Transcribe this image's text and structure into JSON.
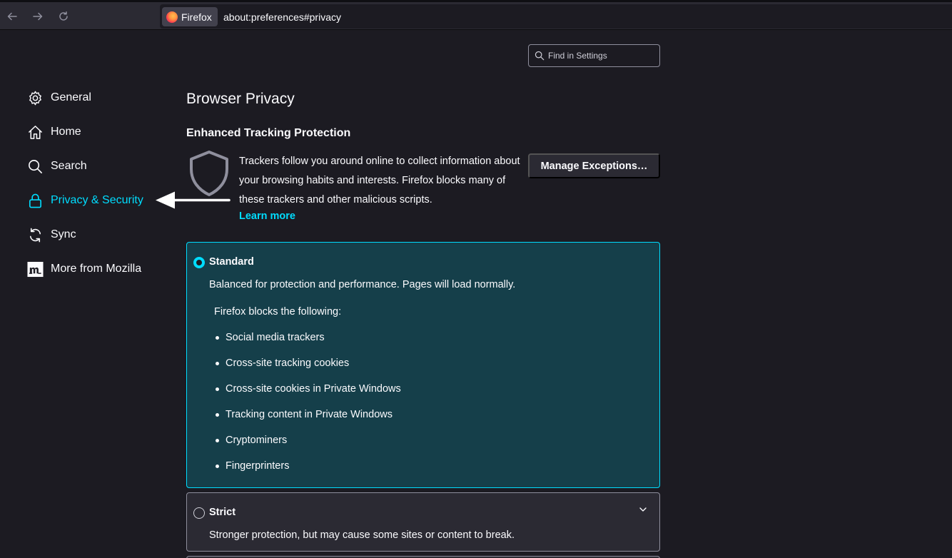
{
  "browser": {
    "identity_label": "Firefox",
    "url": "about:preferences#privacy"
  },
  "search": {
    "placeholder": "Find in Settings"
  },
  "sidebar": {
    "items": [
      {
        "label": "General",
        "icon": "gear-icon"
      },
      {
        "label": "Home",
        "icon": "home-icon"
      },
      {
        "label": "Search",
        "icon": "search-icon"
      },
      {
        "label": "Privacy & Security",
        "icon": "lock-icon",
        "active": true
      },
      {
        "label": "Sync",
        "icon": "sync-icon"
      },
      {
        "label": "More from Mozilla",
        "icon": "mozilla-icon"
      }
    ]
  },
  "main": {
    "title": "Browser Privacy",
    "etp": {
      "heading": "Enhanced Tracking Protection",
      "description": "Trackers follow you around online to collect information about your browsing habits and interests. Firefox blocks many of these trackers and other malicious scripts.",
      "learn_more": "Learn more",
      "manage_button": "Manage Exceptions…"
    },
    "options": {
      "standard": {
        "label": "Standard",
        "description": "Balanced for protection and performance. Pages will load normally.",
        "blocks_title": "Firefox blocks the following:",
        "blocks": [
          "Social media trackers",
          "Cross-site tracking cookies",
          "Cross-site cookies in Private Windows",
          "Tracking content in Private Windows",
          "Cryptominers",
          "Fingerprinters"
        ],
        "selected": true
      },
      "strict": {
        "label": "Strict",
        "description": "Stronger protection, but may cause some sites or content to break.",
        "selected": false
      }
    }
  },
  "colors": {
    "accent": "#00ddff",
    "background": "#1c1b22",
    "selected_card": "#153f4a"
  }
}
